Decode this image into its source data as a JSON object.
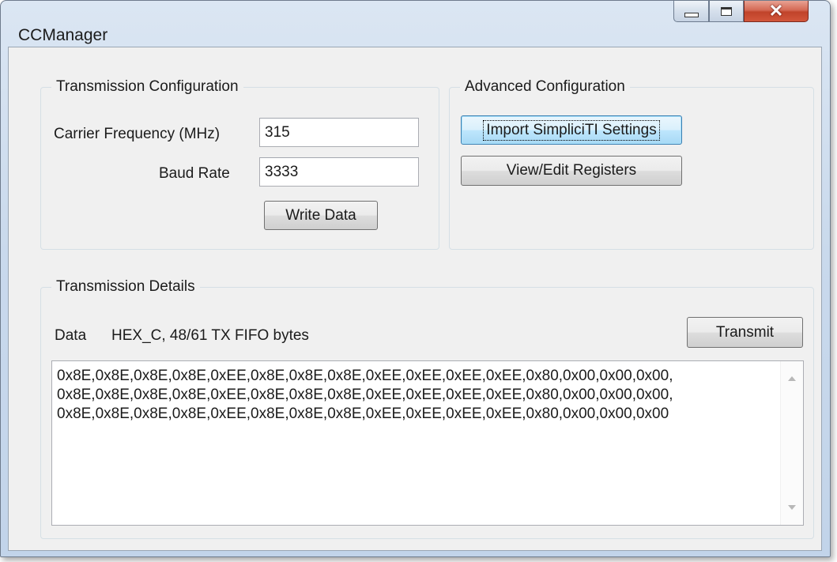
{
  "window": {
    "title": "CCManager"
  },
  "transmission_config": {
    "legend": "Transmission Configuration",
    "carrier_label": "Carrier Frequency (MHz)",
    "carrier_value": "315",
    "baud_label": "Baud Rate",
    "baud_value": "3333",
    "write_button": "Write Data"
  },
  "advanced_config": {
    "legend": "Advanced Configuration",
    "import_button": "Import SimpliciTI Settings",
    "registers_button": "View/Edit Registers"
  },
  "transmission_details": {
    "legend": "Transmission Details",
    "data_label": "Data",
    "data_info": "HEX_C, 48/61 TX FIFO bytes",
    "transmit_button": "Transmit",
    "data_text": "0x8E,0x8E,0x8E,0x8E,0xEE,0x8E,0x8E,0x8E,0xEE,0xEE,0xEE,0xEE,0x80,0x00,0x00,0x00,\n0x8E,0x8E,0x8E,0x8E,0xEE,0x8E,0x8E,0x8E,0xEE,0xEE,0xEE,0xEE,0x80,0x00,0x00,0x00,\n0x8E,0x8E,0x8E,0x8E,0xEE,0x8E,0x8E,0x8E,0xEE,0xEE,0xEE,0xEE,0x80,0x00,0x00,0x00"
  },
  "icons": {
    "minimize": "minimize-icon",
    "maximize": "maximize-icon",
    "close": "close-icon",
    "scroll_up": "scroll-up-arrow-icon",
    "scroll_down": "scroll-down-arrow-icon"
  },
  "colors": {
    "title_bar": "#c9d9ec",
    "close_button": "#c0432a",
    "client_background": "#f0f0f0",
    "focus_button": "#bee6fd"
  }
}
